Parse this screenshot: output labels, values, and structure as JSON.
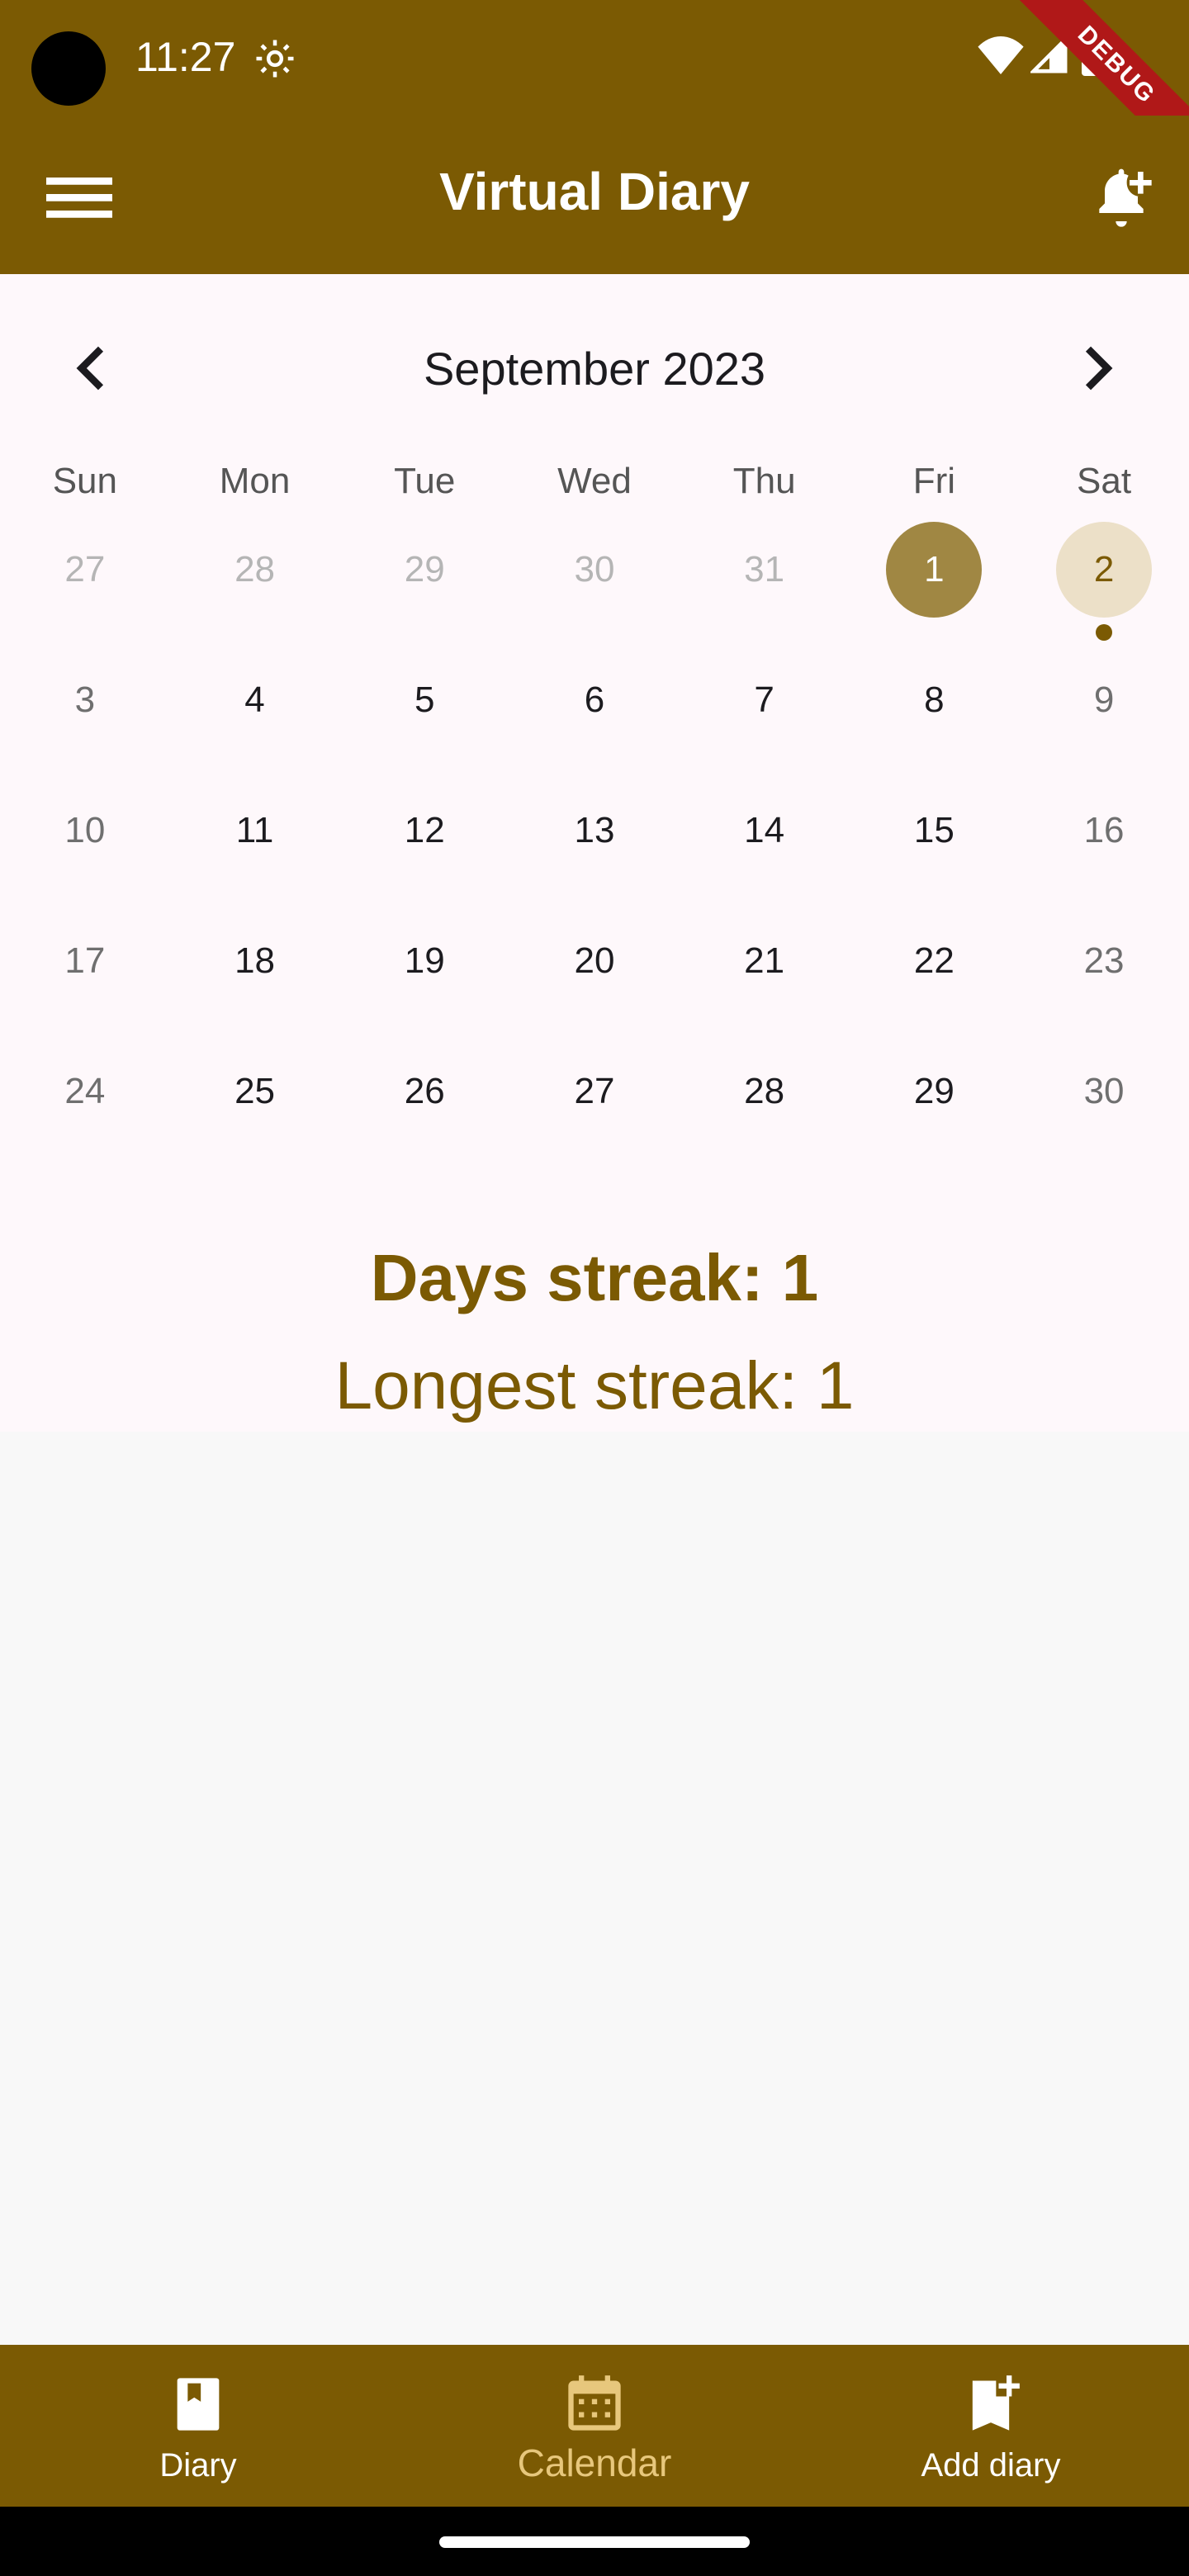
{
  "status_bar": {
    "time": "11:27",
    "debug_label": "DEBUG"
  },
  "app_bar": {
    "title": "Virtual Diary",
    "menu_icon": "hamburger-menu-icon",
    "action_icon": "bell-plus-icon"
  },
  "calendar": {
    "month_title": "September 2023",
    "days_of_week": [
      "Sun",
      "Mon",
      "Tue",
      "Wed",
      "Thu",
      "Fri",
      "Sat"
    ],
    "weeks": [
      [
        {
          "label": "27",
          "state": "outside"
        },
        {
          "label": "28",
          "state": "outside"
        },
        {
          "label": "29",
          "state": "outside"
        },
        {
          "label": "30",
          "state": "outside"
        },
        {
          "label": "31",
          "state": "outside"
        },
        {
          "label": "1",
          "state": "selected"
        },
        {
          "label": "2",
          "state": "today",
          "has_event": true
        }
      ],
      [
        {
          "label": "3",
          "state": "weekend"
        },
        {
          "label": "4",
          "state": "normal"
        },
        {
          "label": "5",
          "state": "normal"
        },
        {
          "label": "6",
          "state": "normal"
        },
        {
          "label": "7",
          "state": "normal"
        },
        {
          "label": "8",
          "state": "normal"
        },
        {
          "label": "9",
          "state": "weekend"
        }
      ],
      [
        {
          "label": "10",
          "state": "weekend"
        },
        {
          "label": "11",
          "state": "normal"
        },
        {
          "label": "12",
          "state": "normal"
        },
        {
          "label": "13",
          "state": "normal"
        },
        {
          "label": "14",
          "state": "normal"
        },
        {
          "label": "15",
          "state": "normal"
        },
        {
          "label": "16",
          "state": "weekend"
        }
      ],
      [
        {
          "label": "17",
          "state": "weekend"
        },
        {
          "label": "18",
          "state": "normal"
        },
        {
          "label": "19",
          "state": "normal"
        },
        {
          "label": "20",
          "state": "normal"
        },
        {
          "label": "21",
          "state": "normal"
        },
        {
          "label": "22",
          "state": "normal"
        },
        {
          "label": "23",
          "state": "weekend"
        }
      ],
      [
        {
          "label": "24",
          "state": "weekend"
        },
        {
          "label": "25",
          "state": "normal"
        },
        {
          "label": "26",
          "state": "normal"
        },
        {
          "label": "27",
          "state": "normal"
        },
        {
          "label": "28",
          "state": "normal"
        },
        {
          "label": "29",
          "state": "normal"
        },
        {
          "label": "30",
          "state": "weekend"
        }
      ]
    ]
  },
  "streaks": {
    "days_streak": "Days streak: 1",
    "longest_streak": "Longest streak: 1"
  },
  "bottom_nav": {
    "items": [
      {
        "label": "Diary",
        "icon": "book-icon",
        "active": false
      },
      {
        "label": "Calendar",
        "icon": "calendar-icon",
        "active": true
      },
      {
        "label": "Add diary",
        "icon": "bookmark-add-icon",
        "active": false
      }
    ]
  },
  "colors": {
    "primary": "#7b5a03",
    "selected_day": "#a08743",
    "today_day": "#ece0c8",
    "active_nav": "#e7c77c",
    "calendar_bg": "#fef8fb"
  }
}
